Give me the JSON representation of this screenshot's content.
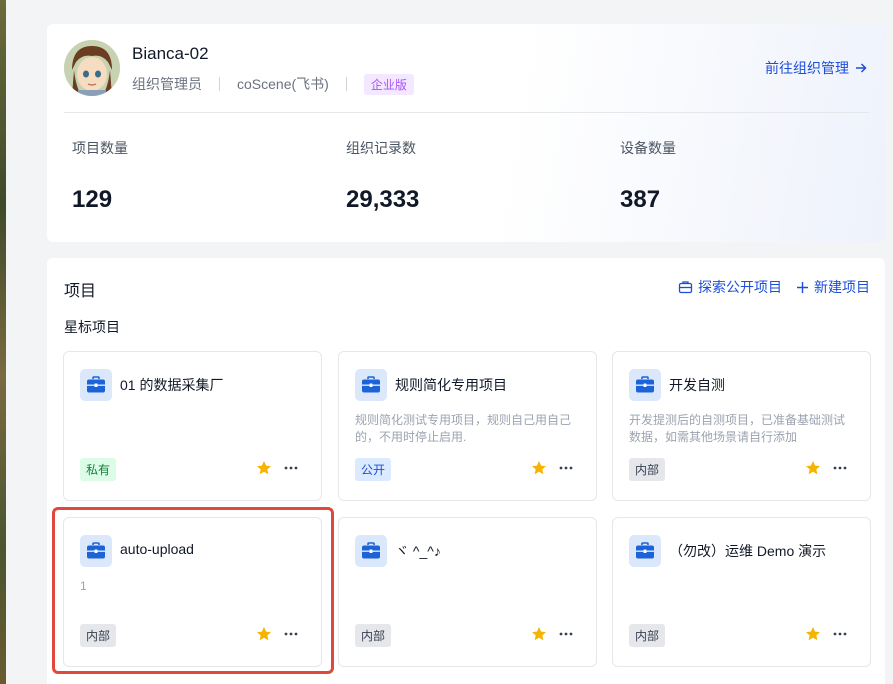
{
  "profile": {
    "name": "Bianca-02",
    "role": "组织管理员",
    "org": "coScene(飞书)",
    "edition": "企业版",
    "org_link": "前往组织管理"
  },
  "stats": [
    {
      "label": "项目数量",
      "value": "129"
    },
    {
      "label": "组织记录数",
      "value": "29,333"
    },
    {
      "label": "设备数量",
      "value": "387"
    }
  ],
  "projects": {
    "title": "项目",
    "explore_label": "探索公开项目",
    "new_label": "新建项目",
    "section": "星标项目",
    "cards": [
      {
        "name": "01 的数据采集厂",
        "desc": "",
        "tag": "私有",
        "tag_type": "private"
      },
      {
        "name": "规则简化专用项目",
        "desc": "规则简化测试专用项目，规则自己用自己的，不用时停止启用.",
        "tag": "公开",
        "tag_type": "public"
      },
      {
        "name": "开发自测",
        "desc": "开发提测后的自测项目，已准备基础测试数据，如需其他场景请自行添加",
        "tag": "内部",
        "tag_type": "internal"
      },
      {
        "name": "auto-upload",
        "desc": "1",
        "tag": "内部",
        "tag_type": "internal"
      },
      {
        "name": "ヾ ^_^♪",
        "desc": "",
        "tag": "内部",
        "tag_type": "internal"
      },
      {
        "name": "（勿改）运维 Demo 演示",
        "desc": "",
        "tag": "内部",
        "tag_type": "internal"
      }
    ]
  },
  "colors": {
    "accent": "#1d4ed8",
    "star": "#f5b400",
    "highlight": "#e0483e"
  },
  "icons": [
    "briefcase-icon",
    "star-icon",
    "more-icon",
    "arrow-right-icon",
    "plus-icon",
    "explore-icon"
  ]
}
